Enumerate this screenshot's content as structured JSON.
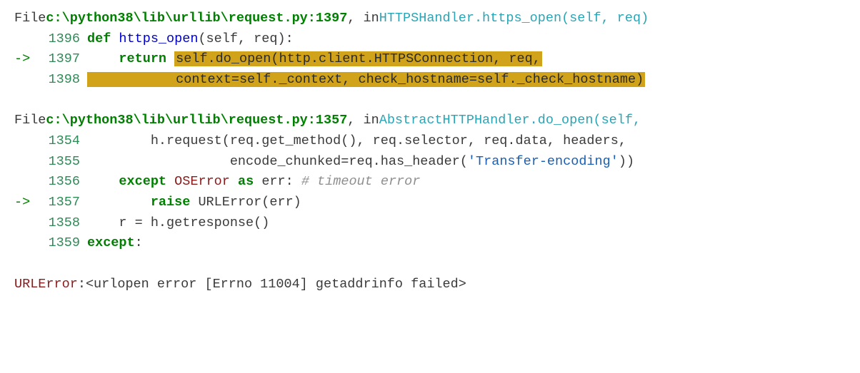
{
  "colors": {
    "highlight": "#d1a31a",
    "keyword": "#008000",
    "function": "#0000cc",
    "cyan": "#2aa5b5",
    "filepath": "#008000",
    "error": "#8b1a1a",
    "string": "#1a5fb4",
    "comment": "#8f8f8f"
  },
  "frame1": {
    "file_label": "File ",
    "path": "c:\\python38\\lib\\urllib\\request.py:1397",
    "in_label": ", in ",
    "class_fn": "HTTPSHandler.https_open",
    "sig": "(self, req)",
    "lines": {
      "l1396": {
        "arrow": "",
        "no": "1396",
        "def_kw": "def",
        "space1": " ",
        "fn_name": "https_open",
        "rest": "(self, req):"
      },
      "l1397": {
        "arrow": "->",
        "no": "1397",
        "indent": "    ",
        "ret_kw": "return",
        "space1": " ",
        "hl_text": "self.do_open(http.client.HTTPSConnection, req,"
      },
      "l1398": {
        "arrow": "",
        "no": "1398",
        "indent": "",
        "hl_pad": "           context",
        "eq1": "=",
        "self_ctx": "self._context",
        "comma": ", check_hostname",
        "eq2": "=",
        "self_chk": "self._check_hostname",
        "paren": ")"
      }
    }
  },
  "frame2": {
    "file_label": "File ",
    "path": "c:\\python38\\lib\\urllib\\request.py:1357",
    "in_label": ", in ",
    "class_fn": "AbstractHTTPHandler.do_open",
    "sig": "(self,",
    "lines": {
      "l1354": {
        "arrow": "",
        "no": "1354",
        "text": "        h.request(req.get_method(), req.selector, req.data, headers,"
      },
      "l1355": {
        "arrow": "",
        "no": "1355",
        "pre": "                  encode_chunked",
        "eq": "=",
        "mid": "req.has_header(",
        "str": "'Transfer-encoding'",
        "post": "))"
      },
      "l1356": {
        "arrow": "",
        "no": "1356",
        "indent": "    ",
        "except_kw": "except",
        "space1": " ",
        "exc_type": "OSError",
        "space2": " ",
        "as_kw": "as",
        "space3": " ",
        "var": "err: ",
        "comment": "# timeout error"
      },
      "l1357": {
        "arrow": "->",
        "no": "1357",
        "indent": "        ",
        "raise_kw": "raise",
        "rest": " URLError(err)"
      },
      "l1358": {
        "arrow": "",
        "no": "1358",
        "text": "    r = h.getresponse()"
      },
      "l1359": {
        "arrow": "",
        "no": "1359",
        "except_kw": "except",
        "colon": ":"
      }
    }
  },
  "error": {
    "name": "URLError",
    "sep": ": ",
    "msg": "<urlopen error [Errno 11004] getaddrinfo failed>"
  }
}
